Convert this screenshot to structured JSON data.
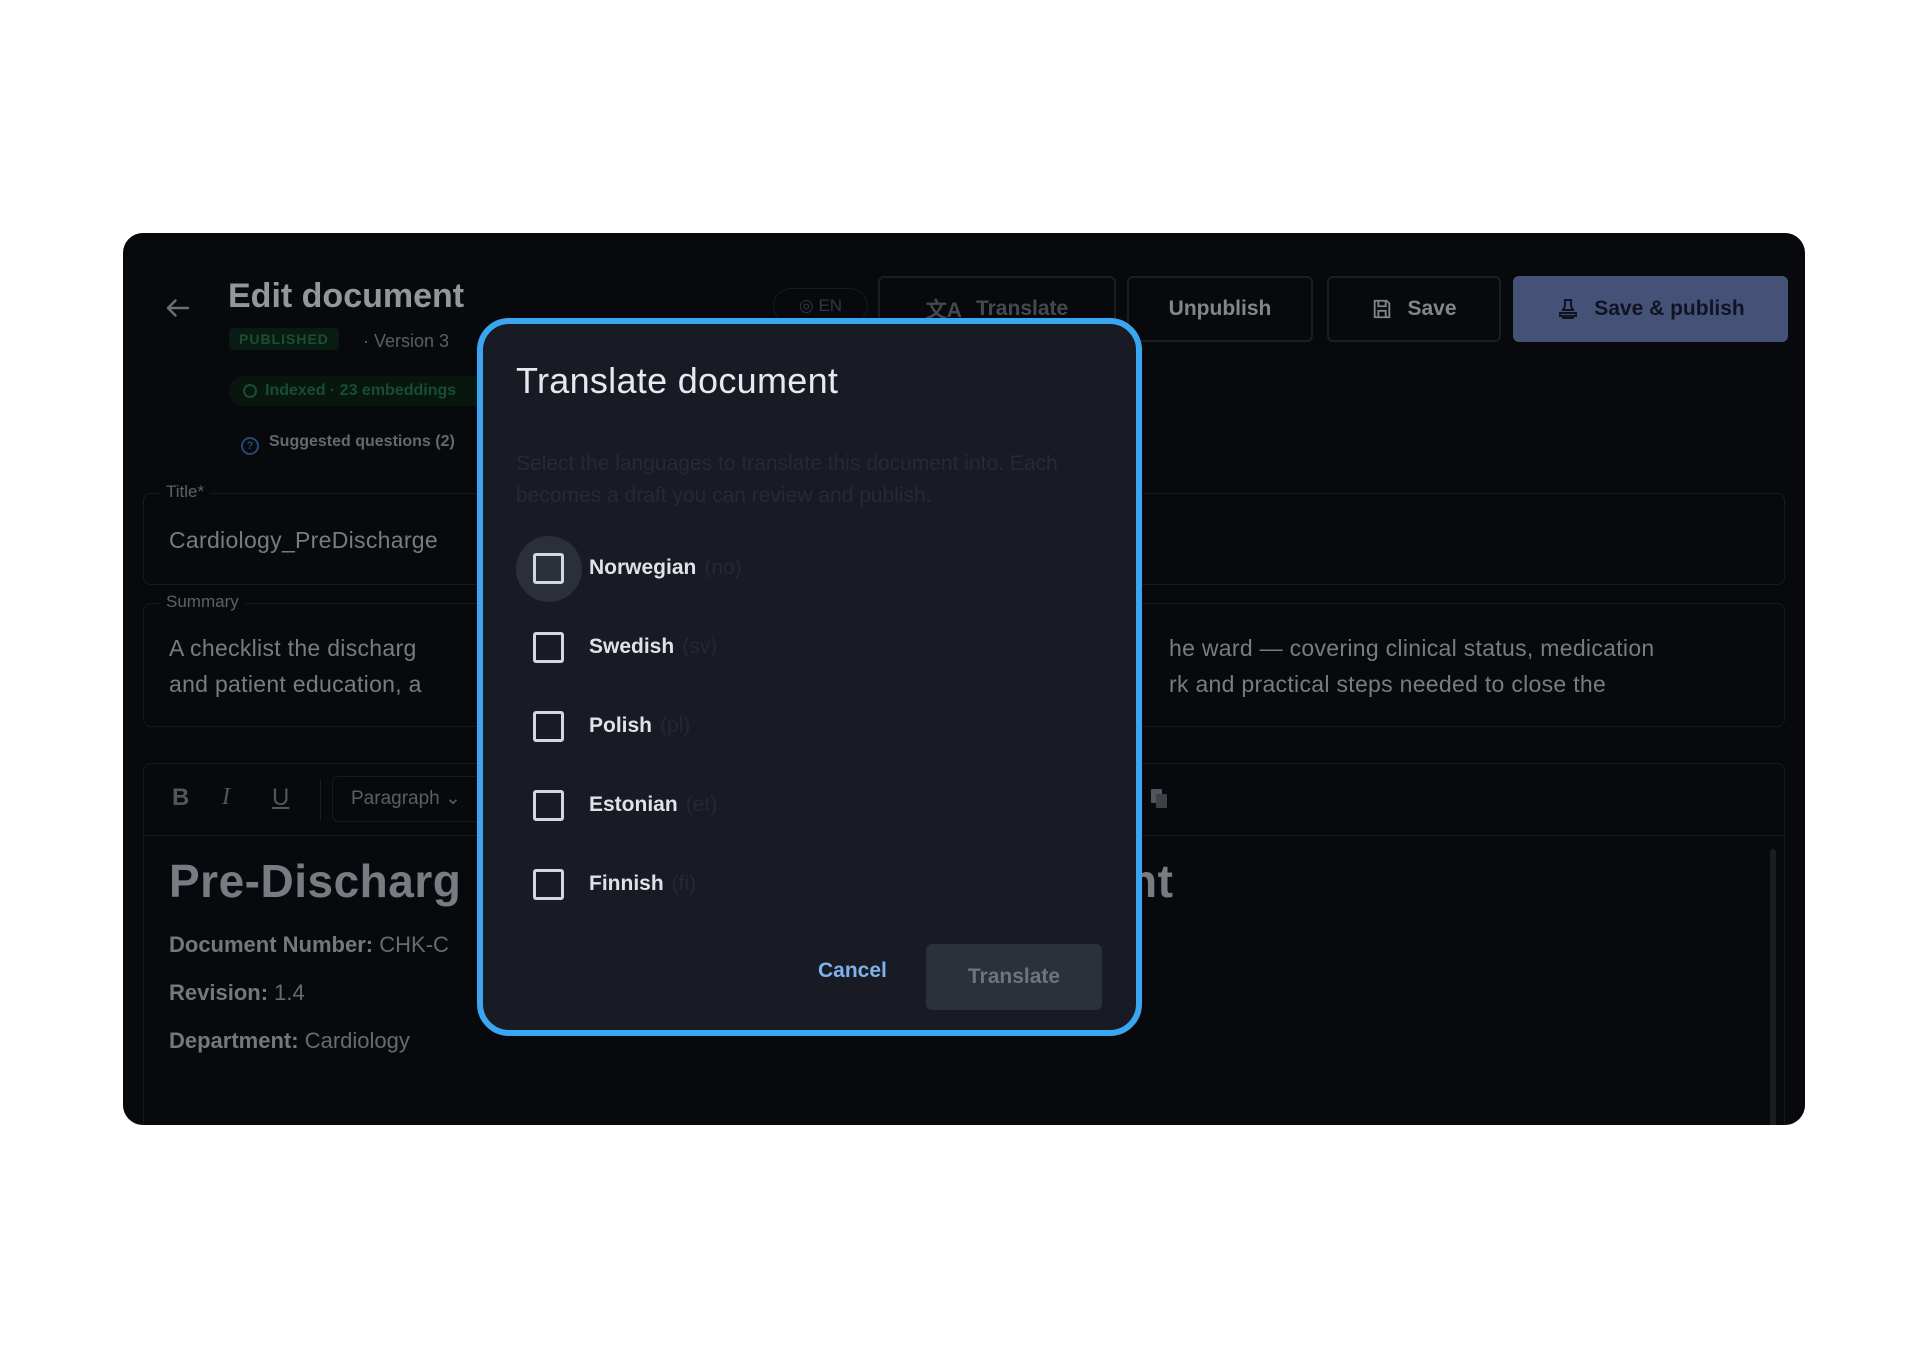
{
  "page": {
    "title": "Edit document",
    "status_badge": "PUBLISHED",
    "version": "· Version 3",
    "indexed": "Indexed · 23 embeddings",
    "suggested": "Suggested questions (2)",
    "lang_pill": "EN",
    "icons": {
      "back": "arrow-left-icon",
      "globe": "globe-icon",
      "translate": "translate-icon",
      "save": "floppy-disk-icon",
      "publish": "stamp-icon",
      "copy": "copy-icon"
    }
  },
  "actions": {
    "translate_label": "Translate",
    "unpublish_label": "Unpublish",
    "save_label": "Save",
    "publish_label": "Save & publish"
  },
  "fields": {
    "title_label": "Title*",
    "title_value": "Cardiology_PreDischarge",
    "summary_label": "Summary",
    "summary_line1_left": "A checklist the discharg",
    "summary_line1_right": "he ward — covering clinical status, medication",
    "summary_line2_left": "and patient education, a",
    "summary_line2_right": "rk and practical steps needed to close the"
  },
  "editor": {
    "bold": "B",
    "italic": "I",
    "underline": "U",
    "paragraph": "Paragraph",
    "heading_left": "Pre-Discharg",
    "heading_right": "nt",
    "doc_number_label": "Document Number:",
    "doc_number_value": "CHK-C",
    "revision_label": "Revision:",
    "revision_value": "1.4",
    "department_label": "Department:",
    "department_value": "Cardiology"
  },
  "modal": {
    "title": "Translate document",
    "description": "Select the languages to translate this document into. Each becomes a draft you can review and publish.",
    "options": [
      {
        "label": "Norwegian",
        "code": "(no)",
        "checked": false
      },
      {
        "label": "Swedish",
        "code": "(sv)",
        "checked": false
      },
      {
        "label": "Polish",
        "code": "(pl)",
        "checked": false
      },
      {
        "label": "Estonian",
        "code": "(et)",
        "checked": false
      },
      {
        "label": "Finnish",
        "code": "(fi)",
        "checked": false
      }
    ],
    "cancel_label": "Cancel",
    "translate_label": "Translate"
  },
  "colors": {
    "accent": "#3ba6f0",
    "primary_button": "#6b7fb8",
    "background": "#0c0e13",
    "modal": "#181b23"
  }
}
